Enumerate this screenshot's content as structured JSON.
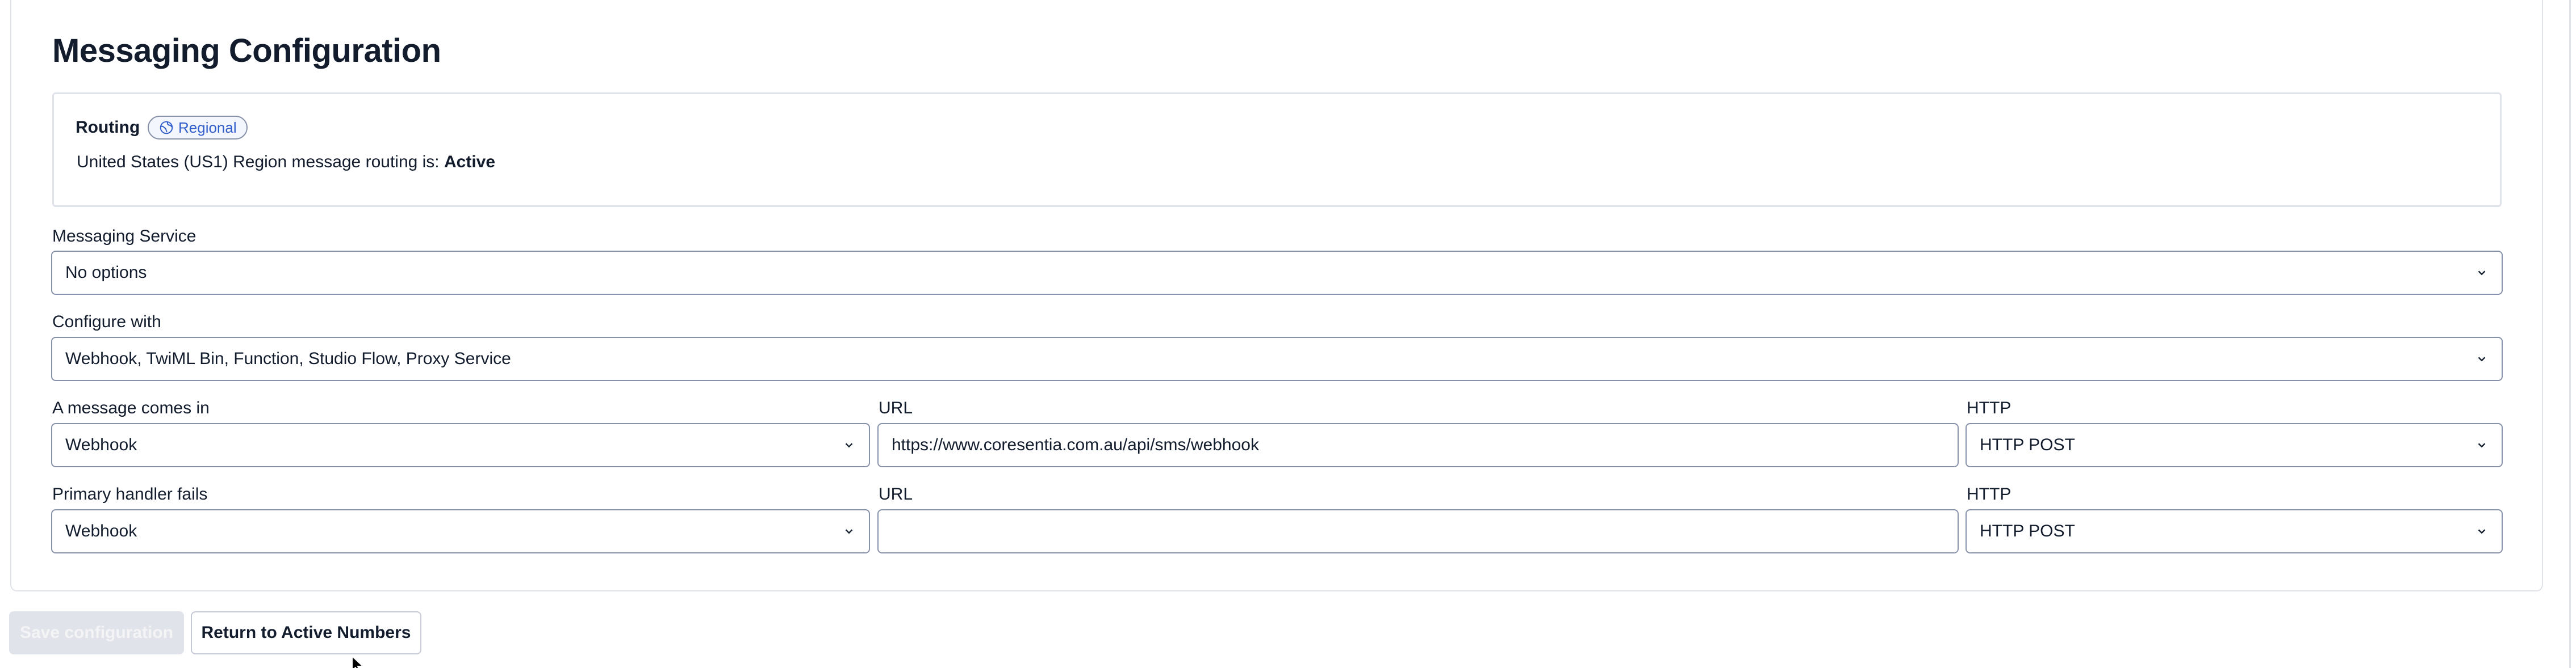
{
  "page": {
    "title": "Messaging Configuration"
  },
  "routing": {
    "label": "Routing",
    "badge": "Regional",
    "badge_icon": "globe-icon",
    "message_prefix": "United States (US1) Region message routing is: ",
    "status": "Active"
  },
  "messaging_service": {
    "label": "Messaging Service",
    "value": "No options"
  },
  "configure_with": {
    "label": "Configure with",
    "value": "Webhook, TwiML Bin, Function, Studio Flow, Proxy Service"
  },
  "incoming": {
    "label": "A message comes in",
    "value": "Webhook",
    "url_label": "URL",
    "url_value": "https://www.coresentia.com.au/api/sms/webhook",
    "http_label": "HTTP",
    "http_value": "HTTP POST"
  },
  "fallback": {
    "label": "Primary handler fails",
    "value": "Webhook",
    "url_label": "URL",
    "url_value": "",
    "http_label": "HTTP",
    "http_value": "HTTP POST"
  },
  "actions": {
    "save_label": "Save configuration",
    "save_disabled": true,
    "return_label": "Return to Active Numbers"
  },
  "colors": {
    "text": "#121c2d",
    "border": "#8891aa",
    "link_blue": "#2f5dcc",
    "disabled_button": "#e1e3ea"
  }
}
